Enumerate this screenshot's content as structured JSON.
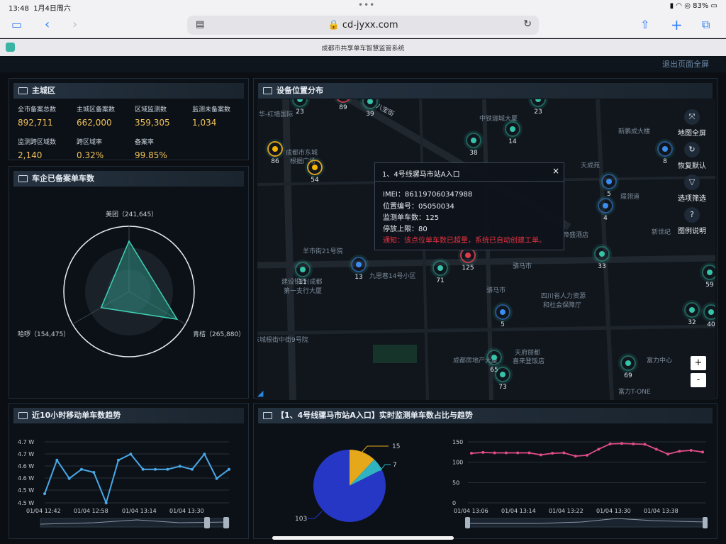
{
  "status_bar": {
    "time": "13:48",
    "date": "1月4日周六",
    "battery": "83%"
  },
  "browser": {
    "url": "cd-jyxx.com",
    "tab_title": "成都市共享单车智慧监管系统"
  },
  "header": {
    "exit_fullscreen": "退出页面全屏"
  },
  "main_district": {
    "title": "主城区",
    "stats": [
      {
        "label": "全市备案总数",
        "value": "892,711"
      },
      {
        "label": "主城区备案数",
        "value": "662,000"
      },
      {
        "label": "区域监测数",
        "value": "359,305"
      },
      {
        "label": "监测未备案数",
        "value": "1,034"
      },
      {
        "label": "监测跨区域数",
        "value": "2,140"
      },
      {
        "label": "跨区域率",
        "value": "0.32%"
      },
      {
        "label": "备案率",
        "value": "99.85%"
      }
    ]
  },
  "companies": {
    "title": "车企已备案单车数",
    "chart_data": {
      "type": "radar",
      "categories": [
        "美团",
        "青桔",
        "哈啰"
      ],
      "values": [
        241645,
        265880,
        154475
      ],
      "labels": [
        "美团（241,645）",
        "青桔（265,880）",
        "哈啰（154,475）"
      ]
    }
  },
  "map_panel": {
    "title": "设备位置分布",
    "controls": [
      {
        "label": "地图全屏",
        "icon": "fullscreen-icon"
      },
      {
        "label": "恢复默认",
        "icon": "refresh-icon"
      },
      {
        "label": "选项筛选",
        "icon": "filter-icon"
      },
      {
        "label": "图例说明",
        "icon": "help-icon"
      }
    ],
    "pois": [
      "华-红墙国际",
      "成都市东城",
      "根据广场",
      "中铁瑞城大厦",
      "新鹏成大楼",
      "天成苑",
      "璟翎道",
      "帝盛酒店",
      "新世纪",
      "羊市街21号院",
      "建设银行(成都",
      "第一支行大厦",
      "九思巷14号小区",
      "骆马市",
      "骆马市",
      "四川省人力资源",
      "和社会保障厅",
      "东城根街中街9号院",
      "成都房地产大厦",
      "天府丽都",
      "喜来登饭店",
      "富力中心",
      "富力T-ONE",
      "八宝街"
    ],
    "markers": [
      "23",
      "89",
      "39",
      "23",
      "14",
      "38",
      "86",
      "54",
      "8",
      "5",
      "4",
      "13",
      "11",
      "71",
      "125",
      "33",
      "59",
      "5",
      "32",
      "40",
      "69",
      "65",
      "73"
    ],
    "popup": {
      "title": "1、4号线骡马市站A入口",
      "close": "×",
      "imei": "IMEI：861197060347988",
      "location": "位置编号：05050034",
      "monitored": "监测单车数：125",
      "limit": "停放上限：80",
      "notice": "通知：该点位单车数已超量，系统已自动创建工单。"
    },
    "zoom": {
      "in": "+",
      "out": "-"
    }
  },
  "trend_panel": {
    "title": "近10小时移动单车数趋势",
    "chart_data": {
      "type": "line",
      "y_unit": "W",
      "yticks": [
        "4.7 W",
        "4.7 W",
        "4.6 W",
        "4.6 W",
        "4.5 W",
        "4.5 W"
      ],
      "xticks": [
        "01/04 12:42",
        "01/04 12:58",
        "01/04 13:14",
        "01/04 13:30"
      ],
      "values": [
        4.53,
        4.64,
        4.58,
        4.61,
        4.6,
        4.5,
        4.64,
        4.66,
        4.61,
        4.61,
        4.61,
        4.62,
        4.61,
        4.66,
        4.58,
        4.61
      ],
      "ylim": [
        4.5,
        4.7
      ]
    }
  },
  "station_panel": {
    "title": "【1、4号线骡马市站A入口】实时监测单车数占比与趋势",
    "pie": {
      "type": "pie",
      "values": [
        103,
        15,
        7
      ],
      "labels": [
        "103",
        "15",
        "7"
      ],
      "colors": [
        "#2637c6",
        "#e6a81b",
        "#2fb2c2"
      ]
    },
    "line": {
      "type": "line",
      "yticks": [
        "150",
        "100",
        "50",
        "0"
      ],
      "xticks": [
        "01/04 13:06",
        "01/04 13:14",
        "01/04 13:22",
        "01/04 13:30",
        "01/04 13:38"
      ],
      "values": [
        122,
        124,
        123,
        123,
        123,
        123,
        118,
        122,
        123,
        115,
        117,
        132,
        145,
        146,
        145,
        144,
        132,
        120,
        127,
        129,
        125
      ],
      "ylim": [
        0,
        150
      ]
    }
  }
}
